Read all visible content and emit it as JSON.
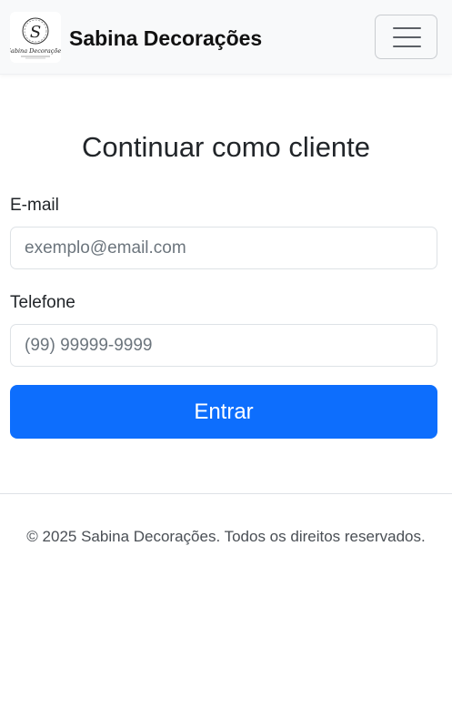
{
  "brand": {
    "name": "Sabina Decorações",
    "logo_monogram": "S",
    "logo_script": "Sabina Decorações",
    "logo_icon": "sabina-logo-icon"
  },
  "navbar": {
    "toggle_icon": "hamburger-menu-icon"
  },
  "form": {
    "title": "Continuar como cliente",
    "email": {
      "label": "E-mail",
      "value": "",
      "placeholder": "exemplo@email.com"
    },
    "phone": {
      "label": "Telefone",
      "value": "",
      "placeholder": "(99) 99999-9999"
    },
    "submit_label": "Entrar"
  },
  "footer": {
    "text": "© 2025 Sabina Decorações. Todos os direitos reservados."
  },
  "colors": {
    "primary": "#0d6efd",
    "navbar_bg": "#f8f9fa",
    "text": "#212529",
    "muted": "#6c757d",
    "border": "#dee2e6"
  }
}
